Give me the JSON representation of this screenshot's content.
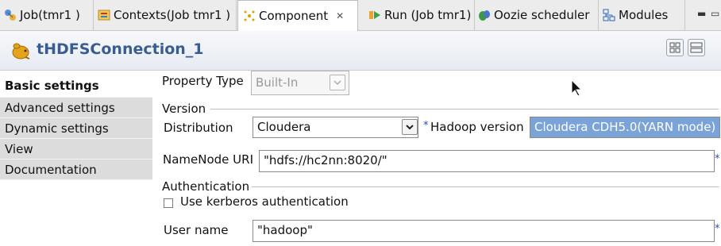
{
  "tabs": [
    {
      "label": "Job(tmr1 )",
      "icon": "job-icon"
    },
    {
      "label": "Contexts(Job tmr1 )",
      "icon": "contexts-icon"
    },
    {
      "label": "Component",
      "icon": "component-icon",
      "active": true
    },
    {
      "label": "Run (Job tmr1)",
      "icon": "run-icon"
    },
    {
      "label": "Oozie scheduler",
      "icon": "oozie-icon"
    },
    {
      "label": "Modules",
      "icon": "modules-icon"
    }
  ],
  "component": {
    "title": "tHDFSConnection_1"
  },
  "nav": {
    "items": [
      {
        "label": "Basic settings",
        "active": true
      },
      {
        "label": "Advanced settings"
      },
      {
        "label": "Dynamic settings"
      },
      {
        "label": "View"
      },
      {
        "label": "Documentation"
      }
    ]
  },
  "form": {
    "property_type_label": "Property Type",
    "property_type_value": "Built-In",
    "version_group": "Version",
    "distribution_label": "Distribution",
    "distribution_value": "Cloudera",
    "hadoop_version_label": "Hadoop version",
    "hadoop_version_value": "Cloudera CDH5.0(YARN mode)",
    "namenode_label": "NameNode URI",
    "namenode_value": "\"hdfs://hc2nn:8020/\"",
    "auth_group": "Authentication",
    "kerberos_label": "Use kerberos authentication",
    "kerberos_checked": false,
    "username_label": "User name",
    "username_value": "\"hadoop\"",
    "required_marker": "*"
  },
  "colors": {
    "accent": "#3a5d8f",
    "selection": "#7aa3d8",
    "required": "#2a4fbd"
  }
}
